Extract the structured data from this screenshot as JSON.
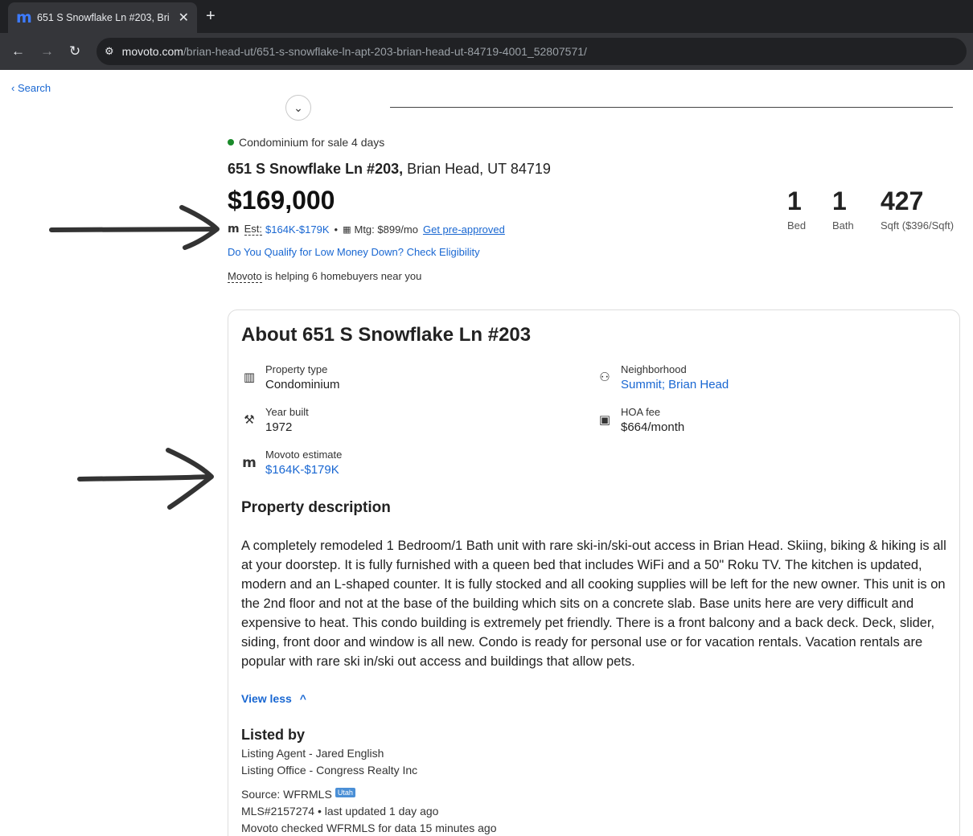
{
  "browser": {
    "tab_title": "651 S Snowflake Ln #203, Brian",
    "tab_favicon": "m",
    "url_host": "movoto.com",
    "url_path": "/brian-head-ut/651-s-snowflake-ln-apt-203-brian-head-ut-84719-4001_52807571/"
  },
  "nav": {
    "search_label": "Search"
  },
  "listing": {
    "status": "Condominium for sale 4 days",
    "address_street": "651 S Snowflake Ln #203,",
    "address_city": " Brian Head, UT 84719",
    "price": "$169,000",
    "est_label": "Est:",
    "est_value": "$164K-$179K",
    "mortgage": "Mtg: $899/mo",
    "preapproved": "Get pre-approved",
    "qualify_link": "Do You Qualify for Low Money Down? Check Eligibility",
    "helping_brand": "Movoto",
    "helping_text": " is helping 6 homebuyers near you",
    "stats": {
      "bed_value": "1",
      "bed_label": "Bed",
      "bath_value": "1",
      "bath_label": "Bath",
      "sqft_value": "427",
      "sqft_label": "Sqft ($396/Sqft)"
    }
  },
  "about": {
    "title": "About 651 S Snowflake Ln #203",
    "property_type_label": "Property type",
    "property_type_value": "Condominium",
    "neighborhood_label": "Neighborhood",
    "neighborhood_value": "Summit; Brian Head",
    "year_built_label": "Year built",
    "year_built_value": "1972",
    "hoa_label": "HOA fee",
    "hoa_value": "$664/month",
    "estimate_label": "Movoto estimate",
    "estimate_value": "$164K-$179K",
    "description_title": "Property description",
    "description": "A completely remodeled 1 Bedroom/1 Bath unit with rare ski-in/ski-out access in Brian Head. Skiing, biking & hiking is all at your doorstep. It is fully furnished with a queen bed that includes WiFi and a 50\" Roku TV. The kitchen is updated, modern and an L-shaped counter. It is fully stocked and all cooking supplies will be left for the new owner. This unit is on the 2nd floor and not at the base of the building which sits on a concrete slab. Base units here are very difficult and expensive to heat. This condo building is extremely pet friendly. There is a front balcony and a back deck. Deck, slider, siding, front door and window is all new. Condo is ready for personal use or for vacation rentals. Vacation rentals are popular with rare ski in/ski out access and buildings that allow pets.",
    "view_less": "View less"
  },
  "listed_by": {
    "title": "Listed by",
    "agent": "Listing Agent - Jared English",
    "office": "Listing Office - Congress Realty Inc",
    "source": "Source: WFRMLS",
    "source_badge": "Utah",
    "mls": "MLS#2157274 • last updated 1 day ago",
    "checked": "Movoto checked WFRMLS for data 15 minutes ago"
  },
  "icons": {
    "back": "chevron-left-icon",
    "property_type": "building-icon",
    "neighborhood": "people-icon",
    "year_built": "paint-roller-icon",
    "hoa": "money-icon",
    "estimate": "movoto-logo-icon"
  }
}
